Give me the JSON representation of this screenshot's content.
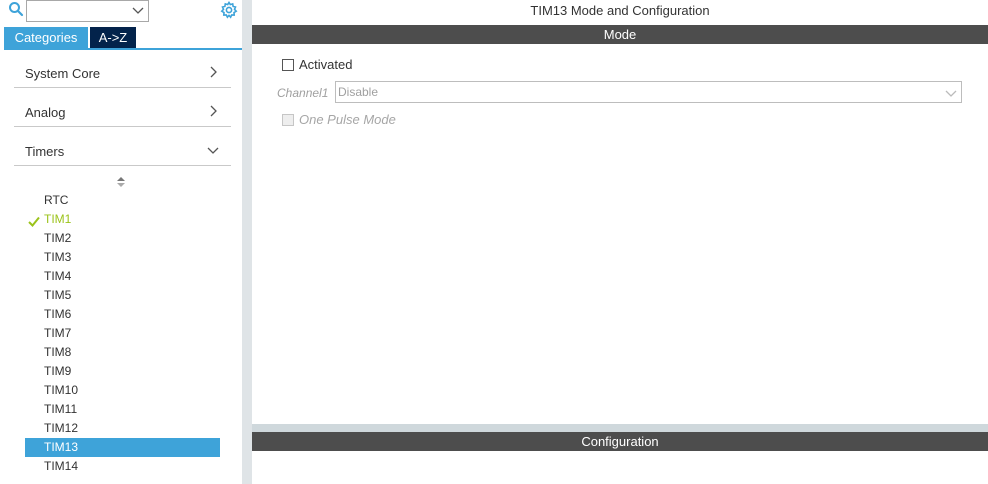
{
  "left": {
    "tabs": {
      "categories": "Categories",
      "az": "A->Z"
    },
    "categories": [
      {
        "label": "System Core",
        "state": "collapsed"
      },
      {
        "label": "Analog",
        "state": "collapsed"
      },
      {
        "label": "Timers",
        "state": "expanded"
      }
    ],
    "timers": [
      {
        "label": "RTC",
        "status": "none",
        "selected": false
      },
      {
        "label": "TIM1",
        "status": "configured",
        "selected": false
      },
      {
        "label": "TIM2",
        "status": "none",
        "selected": false
      },
      {
        "label": "TIM3",
        "status": "none",
        "selected": false
      },
      {
        "label": "TIM4",
        "status": "none",
        "selected": false
      },
      {
        "label": "TIM5",
        "status": "none",
        "selected": false
      },
      {
        "label": "TIM6",
        "status": "none",
        "selected": false
      },
      {
        "label": "TIM7",
        "status": "none",
        "selected": false
      },
      {
        "label": "TIM8",
        "status": "none",
        "selected": false
      },
      {
        "label": "TIM9",
        "status": "none",
        "selected": false
      },
      {
        "label": "TIM10",
        "status": "none",
        "selected": false
      },
      {
        "label": "TIM11",
        "status": "none",
        "selected": false
      },
      {
        "label": "TIM12",
        "status": "none",
        "selected": false
      },
      {
        "label": "TIM13",
        "status": "none",
        "selected": true
      },
      {
        "label": "TIM14",
        "status": "none",
        "selected": false
      }
    ]
  },
  "right": {
    "title": "TIM13 Mode and Configuration",
    "mode_header": "Mode",
    "activated_label": "Activated",
    "activated_checked": false,
    "channel1_label": "Channel1",
    "channel1_value": "Disable",
    "one_pulse_label": "One Pulse Mode",
    "one_pulse_checked": false,
    "config_header": "Configuration"
  },
  "colors": {
    "accent": "#3ea3d9",
    "tab_dark": "#03234b",
    "section_bar": "#4d4d4d",
    "configured_green": "#9bc31a"
  },
  "icons": {
    "search": "search-icon",
    "gear": "gear-icon",
    "category_collapsed": "chevron-right-icon",
    "category_expanded": "chevron-down-icon",
    "sort": "sort-icon",
    "configured": "checkmark-icon"
  }
}
